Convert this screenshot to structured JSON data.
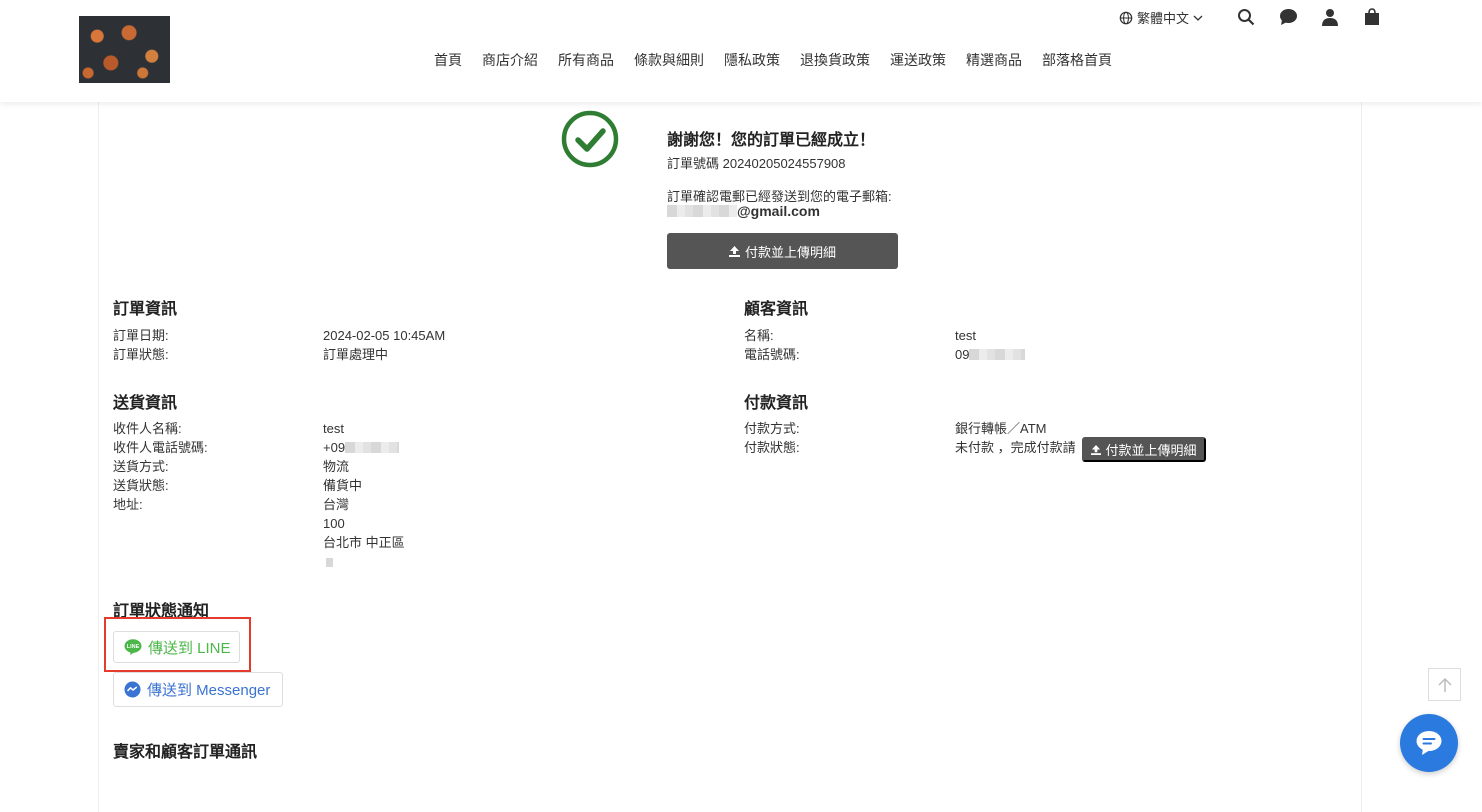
{
  "header": {
    "nav": [
      "首頁",
      "商店介紹",
      "所有商品",
      "條款與細則",
      "隱私政策",
      "退換貨政策",
      "運送政策",
      "精選商品",
      "部落格首頁"
    ],
    "language": "繁體中文",
    "icons": [
      "search-icon",
      "chat-icon",
      "user-icon",
      "cart-icon"
    ]
  },
  "confirmation": {
    "title": "謝謝您！您的訂單已經成立！",
    "order_number": "訂單號碼 20240205024557908",
    "email_note": "訂單確認電郵已經發送到您的電子郵箱:",
    "email_domain": "@gmail.com",
    "pay_button": "付款並上傳明細"
  },
  "order_info": {
    "title": "訂單資訊",
    "date_label": "訂單日期:",
    "date_value": "2024-02-05 10:45AM",
    "status_label": "訂單狀態:",
    "status_value": "訂單處理中"
  },
  "customer_info": {
    "title": "顧客資訊",
    "name_label": "名稱:",
    "name_value": "test",
    "phone_label": "電話號碼:",
    "phone_value": "09"
  },
  "delivery_info": {
    "title": "送貨資訊",
    "recipient_label": "收件人名稱:",
    "recipient_value": "test",
    "recipient_phone_label": "收件人電話號碼:",
    "recipient_phone_value": "+09",
    "method_label": "送貨方式:",
    "method_value": "物流",
    "status_label": "送貨狀態:",
    "status_value": "備貨中",
    "address_label": "地址:",
    "address_country": "台灣",
    "address_zip": "100",
    "address_city": "台北市 中正區"
  },
  "payment_info": {
    "title": "付款資訊",
    "method_label": "付款方式:",
    "method_value": "銀行轉帳／ATM",
    "status_label": "付款狀態:",
    "status_value": "未付款 ，完成付款請",
    "pay_button": "付款並上傳明細"
  },
  "notification": {
    "title": "訂單狀態通知",
    "line_button": "傳送到 LINE",
    "messenger_button": "傳送到 Messenger"
  },
  "messages": {
    "title": "賣家和顧客訂單通訊"
  },
  "colors": {
    "success": "#2e7d32",
    "line": "#4cb749",
    "messenger": "#3a73d1",
    "highlight": "#e53b2c",
    "chat": "#2b7ae0"
  }
}
